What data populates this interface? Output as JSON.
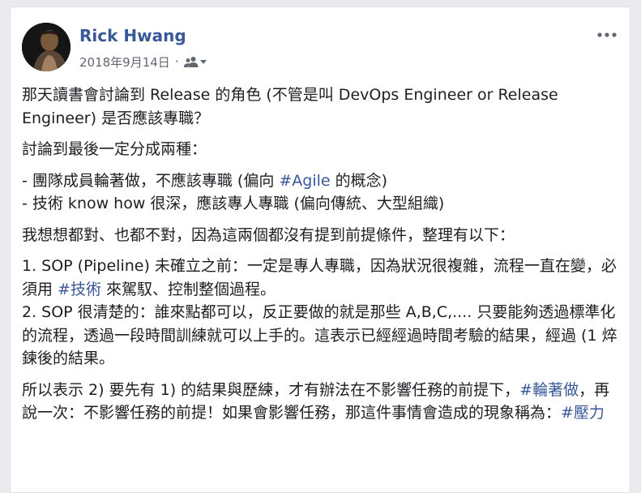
{
  "post": {
    "author": "Rick Hwang",
    "date": "2018年9月14日",
    "dot": "·",
    "audience_icon": "friends-icon",
    "audience_dropdown_icon": "caret-down-icon",
    "more_icon": "more-options-icon"
  },
  "content": {
    "p1": "那天讀書會討論到 Release 的角色 (不管是叫 DevOps Engineer or Release Engineer) 是否應該專職？",
    "p2": "討論到最後一定分成兩種：",
    "p3_l1_a": "- 團隊成員輪著做，不應該專職 (偏向 ",
    "p3_l1_tag": "#Agile",
    "p3_l1_b": " 的概念)",
    "p3_l2": "- 技術 know how 很深，應該專人專職 (偏向傳統、大型組織)",
    "p4": "我想想都對、也都不對，因為這兩個都沒有提到前提條件，整理有以下：",
    "p5_l1_a": "1. SOP (Pipeline) 未確立之前：一定是專人專職，因為狀況很複雜，流程一直在變，必須用 ",
    "p5_l1_tag": "#技術",
    "p5_l1_b": " 來駕馭、控制整個過程。",
    "p5_l2": "2. SOP 很清楚的：誰來點都可以，反正要做的就是那些 A,B,C,.... 只要能夠透過標準化的流程，透過一段時間訓練就可以上手的。這表示已經經過時間考驗的結果，經過 (1 焠鍊後的結果。",
    "p6_a": "所以表示 2) 要先有 1) 的結果與歷練，才有辦法在不影響任務的前提下，",
    "p6_tag1": "#輪著做",
    "p6_b": "，再說一次：不影響任務的前提！如果會影響任務，那這件事情會造成的現象稱為：",
    "p6_tag2": "#壓力"
  },
  "colors": {
    "link": "#385898",
    "text": "#1c1e21",
    "meta": "#616770"
  }
}
